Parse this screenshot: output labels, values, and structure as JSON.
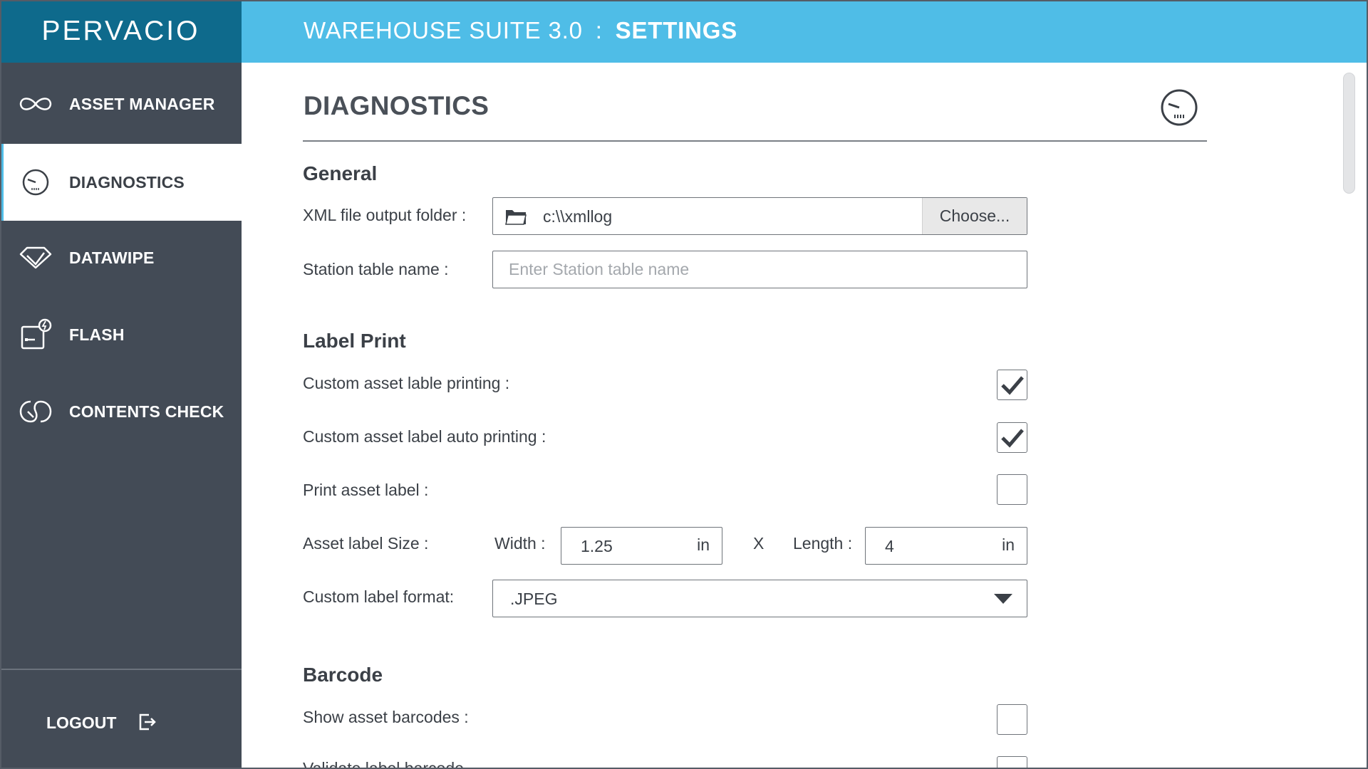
{
  "brand": {
    "logo": "PERVACIO"
  },
  "header": {
    "app_name": "WAREHOUSE SUITE 3.0",
    "separator": ":",
    "section": "SETTINGS"
  },
  "sidebar": {
    "items": [
      {
        "label": "ASSET MANAGER",
        "icon": "infinity-icon",
        "active": false
      },
      {
        "label": "DIAGNOSTICS",
        "icon": "gauge-icon",
        "active": true
      },
      {
        "label": "DATAWIPE",
        "icon": "eraser-icon",
        "active": false
      },
      {
        "label": "FLASH",
        "icon": "flash-icon",
        "active": false
      },
      {
        "label": "CONTENTS CHECK",
        "icon": "contents-check-icon",
        "active": false
      }
    ],
    "logout_label": "LOGOUT"
  },
  "main": {
    "title": "DIAGNOSTICS",
    "general": {
      "heading": "General",
      "xml_label": "XML file output folder :",
      "xml_value": "c:\\\\xmllog",
      "choose_label": "Choose...",
      "station_label": "Station table name :",
      "station_value": "",
      "station_placeholder": "Enter Station table name"
    },
    "label_print": {
      "heading": "Label Print",
      "custom_printing_label": "Custom asset lable printing  :",
      "custom_printing_checked": true,
      "auto_printing_label": "Custom asset label auto printing :",
      "auto_printing_checked": true,
      "print_asset_label": "Print asset label :",
      "print_asset_checked": false,
      "size_label": "Asset label Size  :",
      "width_label": "Width :",
      "width_value": "1.25",
      "width_unit": "in",
      "times_symbol": "X",
      "length_label": "Length :",
      "length_value": "4",
      "length_unit": "in",
      "format_label": "Custom label format:",
      "format_value": ".JPEG"
    },
    "barcode": {
      "heading": "Barcode",
      "show_barcodes_label": "Show asset barcodes :",
      "show_barcodes_checked": false,
      "next_label_partial": "Validate label barcode"
    }
  },
  "colors": {
    "header_bg": "#4fbde7",
    "logo_bg": "#0e6a8c",
    "sidebar_bg": "#434b56",
    "active_accent": "#4fbde7",
    "text": "#3b4047"
  }
}
